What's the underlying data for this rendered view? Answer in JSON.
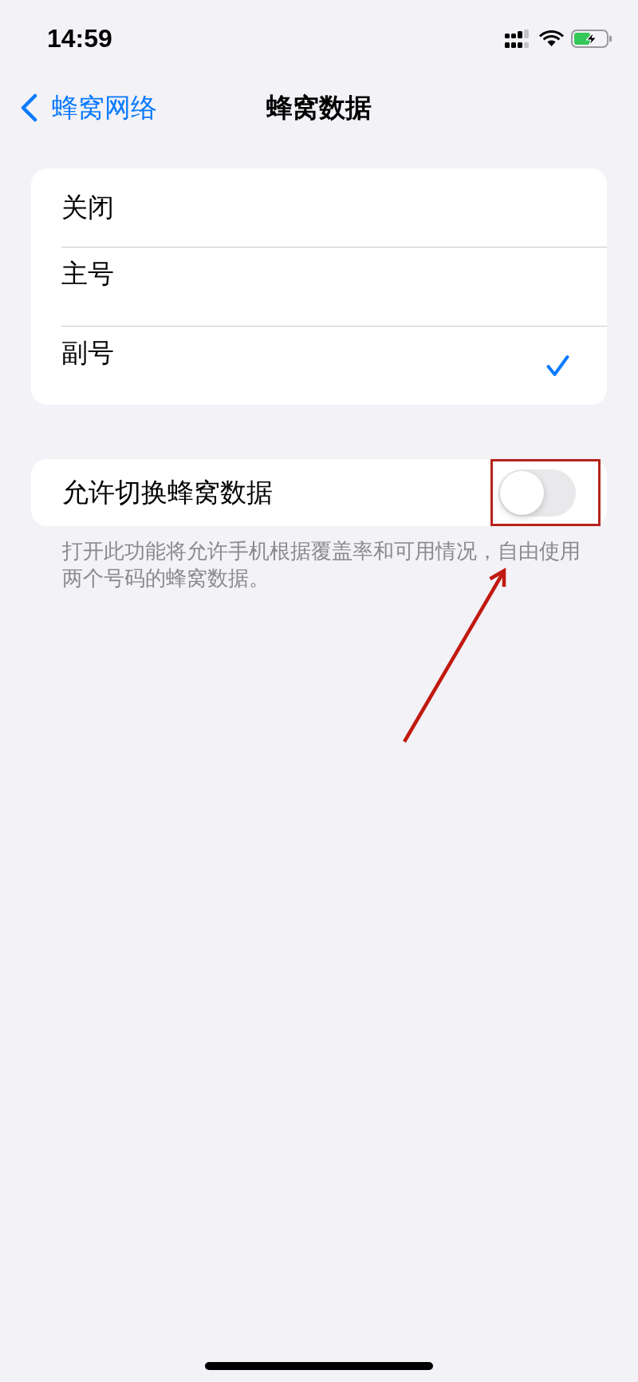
{
  "status_bar": {
    "time": "14:59"
  },
  "nav": {
    "back_label": "蜂窝网络",
    "title": "蜂窝数据"
  },
  "data_line_options": [
    {
      "label": "关闭",
      "selected": false
    },
    {
      "label": "主号",
      "selected": false
    },
    {
      "label": "副号",
      "selected": true
    }
  ],
  "switching": {
    "label": "允许切换蜂窝数据",
    "on": false,
    "footer": "打开此功能将允许手机根据覆盖率和可用情况，自由使用两个号码的蜂窝数据。"
  }
}
